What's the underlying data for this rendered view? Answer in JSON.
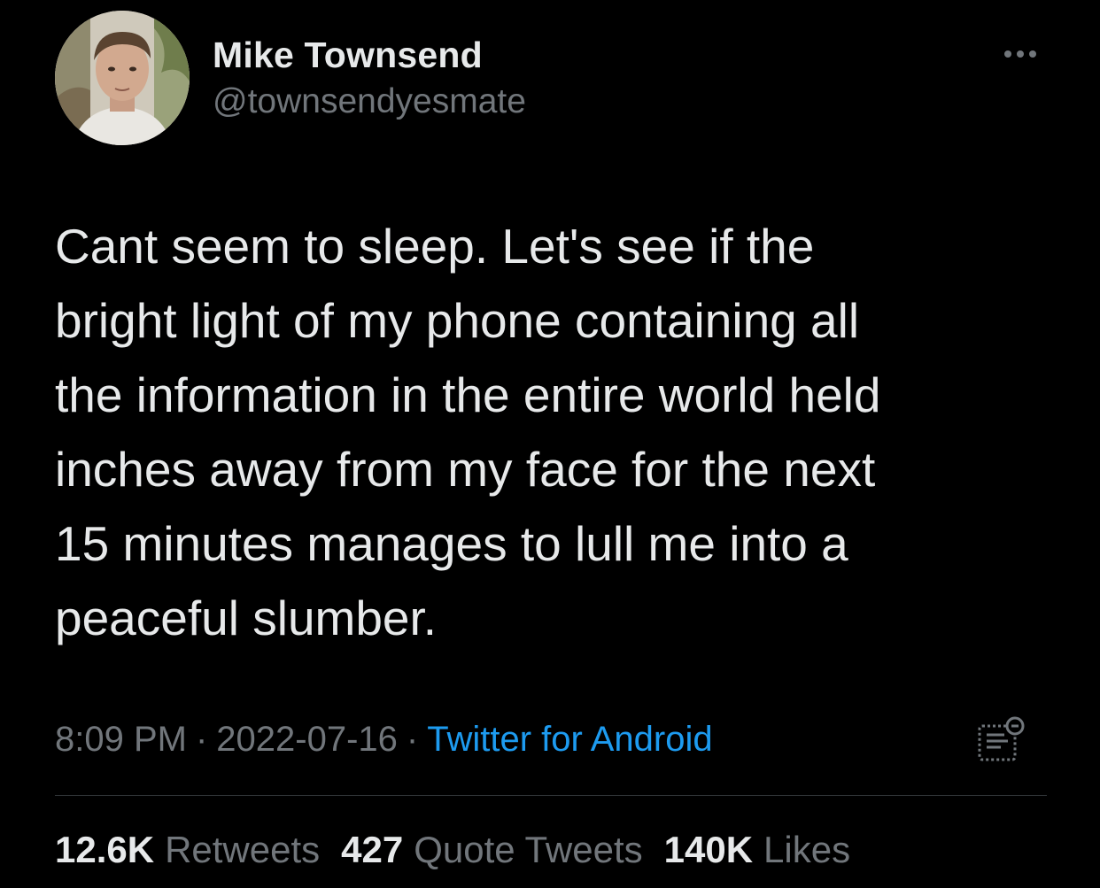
{
  "author": {
    "display_name": "Mike Townsend",
    "handle": "@townsendyesmate",
    "avatar_icon": "profile-photo"
  },
  "tweet": {
    "text": "Cant seem to sleep. Let's see if the\nbright light of my phone containing all\nthe information in the entire world held\ninches away from my face for the next\n15 minutes manages to lull me into a\npeaceful slumber."
  },
  "meta": {
    "time": "8:09 PM",
    "separator": "·",
    "date": "2022-07-16",
    "source": "Twitter for Android"
  },
  "stats": {
    "retweets_count": "12.6K",
    "retweets_label": "Retweets",
    "quotes_count": "427",
    "quotes_label": "Quote Tweets",
    "likes_count": "140K",
    "likes_label": "Likes"
  },
  "icons": {
    "more": "more-icon",
    "analytics": "analytics-icon"
  },
  "colors": {
    "background": "#000000",
    "text": "#e7e9ea",
    "secondary": "#71767b",
    "link": "#1d9bf0",
    "divider": "#2f3336"
  }
}
